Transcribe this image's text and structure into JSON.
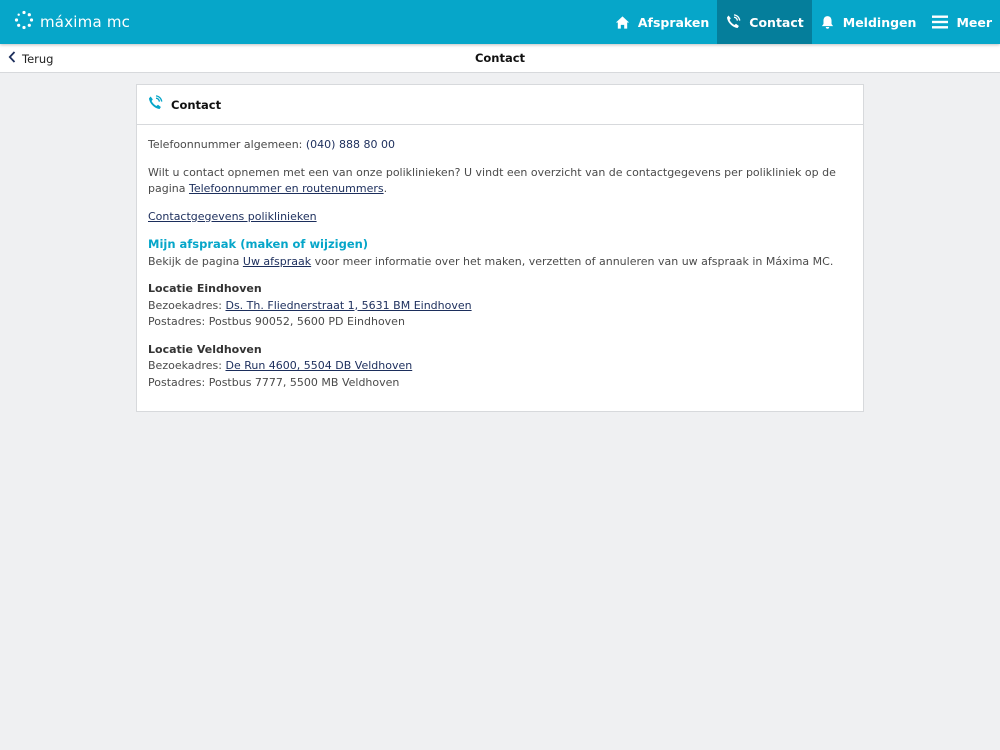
{
  "header": {
    "logo_text": "máxima mc",
    "nav": [
      {
        "label": "Afspraken",
        "icon": "home-icon",
        "active": false
      },
      {
        "label": "Contact",
        "icon": "phone-icon",
        "active": true
      },
      {
        "label": "Meldingen",
        "icon": "bell-icon",
        "active": false
      },
      {
        "label": "Meer",
        "icon": "menu-icon",
        "active": false
      }
    ]
  },
  "subheader": {
    "back_label": "Terug",
    "title": "Contact"
  },
  "card": {
    "title": "Contact",
    "icon": "phone-icon",
    "phone_label": "Telefoonnummer algemeen:",
    "phone_number": "(040) 888 80 00",
    "intro_text": "Wilt u contact opnemen met een van onze poliklinieken? U vindt een overzicht van de contactgegevens per polikliniek op de",
    "intro_text2": "pagina",
    "intro_link": "Telefoonnummer en routenummers",
    "intro_end": ".",
    "contact_link": "Contactgegevens poliklinieken",
    "appointment_heading": "Mijn afspraak (maken of wijzigen)",
    "appointment_pre": "Bekijk de pagina",
    "appointment_link": "Uw afspraak",
    "appointment_post": "voor meer informatie over het maken, verzetten of annuleren van uw afspraak in Máxima MC.",
    "locations": [
      {
        "name": "Locatie Eindhoven",
        "visit_label": "Bezoekadres:",
        "visit_address": "Ds. Th. Fliednerstraat 1, 5631 BM Eindhoven",
        "postal_label": "Postadres:",
        "postal_address": "Postbus 90052, 5600 PD Eindhoven"
      },
      {
        "name": "Locatie Veldhoven",
        "visit_label": "Bezoekadres:",
        "visit_address": "De Run 4600, 5504 DB Veldhoven",
        "postal_label": "Postadres:",
        "postal_address": "Postbus 7777, 5500 MB Veldhoven"
      }
    ]
  },
  "colors": {
    "brand": "#06a6c9",
    "brand_dark": "#057e9b",
    "link": "#1c2e5c",
    "background": "#eff0f2"
  }
}
